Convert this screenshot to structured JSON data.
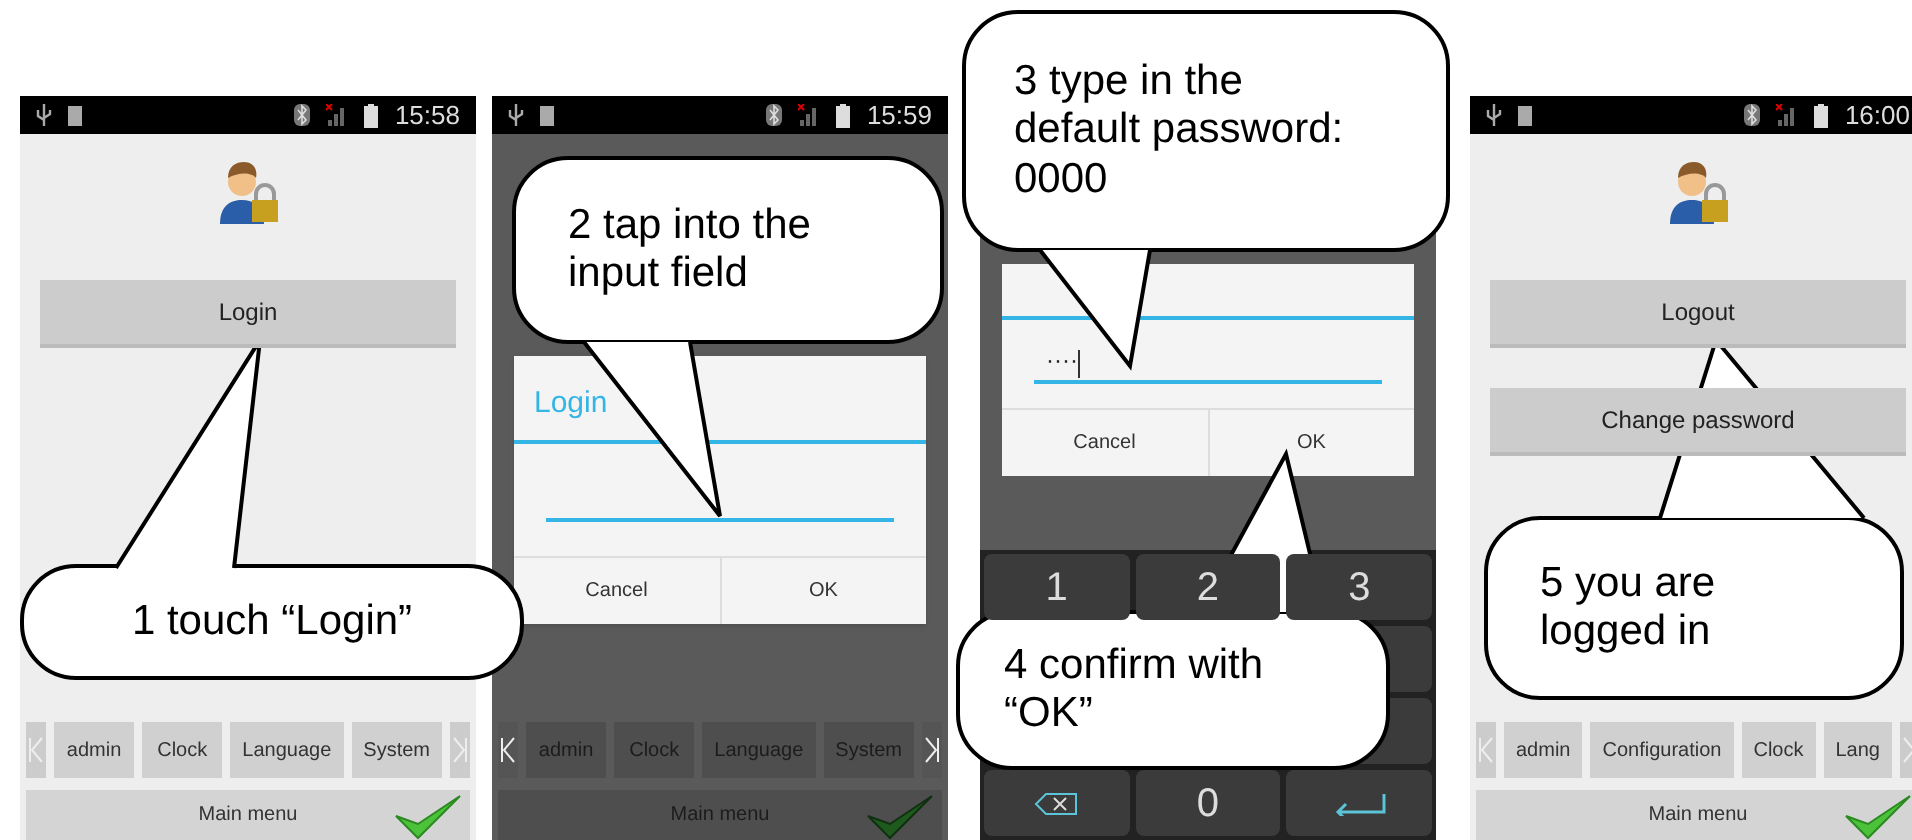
{
  "screens": [
    {
      "kind": "menu",
      "dimmed": false,
      "time": "15:58",
      "buttons": [
        "Login"
      ],
      "tabs": [
        "admin",
        "Clock",
        "Language",
        "System"
      ],
      "main_menu": "Main menu"
    },
    {
      "kind": "dialog",
      "dimmed": true,
      "time": "15:59",
      "dialog": {
        "title": "Login",
        "buttons": [
          "Cancel",
          "OK"
        ]
      },
      "tabs": [
        "admin",
        "Clock",
        "Language",
        "System"
      ],
      "main_menu": "Main menu"
    },
    {
      "kind": "keypad",
      "dimmed": true,
      "password": "····",
      "buttons": [
        "Cancel",
        "OK"
      ],
      "keys": [
        "1",
        "2",
        "3",
        "0"
      ]
    },
    {
      "kind": "menu",
      "dimmed": false,
      "time": "16:00",
      "buttons": [
        "Logout",
        "Change password"
      ],
      "tabs": [
        "admin",
        "Configuration",
        "Clock",
        "Lang"
      ],
      "main_menu": "Main menu"
    }
  ],
  "callouts": [
    {
      "text": "1 touch “Login”"
    },
    {
      "text": "2 tap into the input field"
    },
    {
      "text": "3 type in the default password: 0000"
    },
    {
      "text": "4 confirm with “OK”"
    },
    {
      "text": "5 you are logged in"
    }
  ]
}
